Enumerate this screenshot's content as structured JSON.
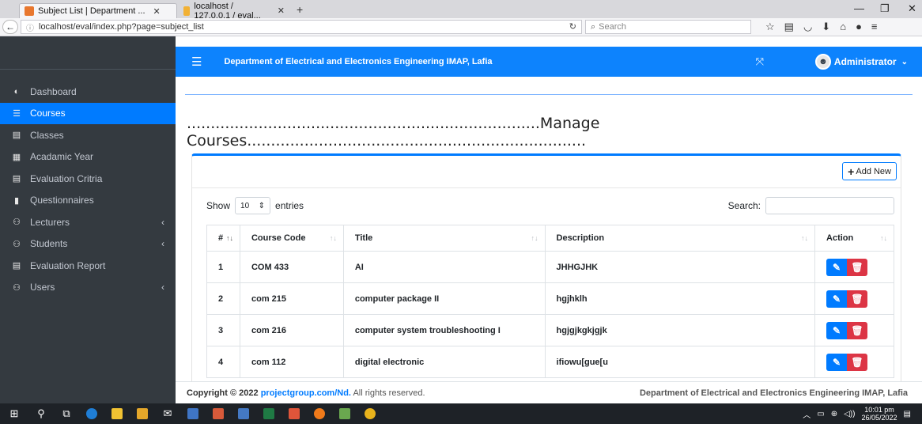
{
  "browser": {
    "tabs": [
      {
        "title": "Subject List | Department ...",
        "active": true
      },
      {
        "title": "localhost / 127.0.0.1 / eval...",
        "active": false
      }
    ],
    "new_tab": "+",
    "url": "localhost/eval/index.php?page=subject_list",
    "search_placeholder": "Search"
  },
  "navbar": {
    "title": "Department of Electrical and Electronics Engineering IMAP, Lafia",
    "user": "Administrator"
  },
  "sidebar": {
    "items": [
      {
        "label": "Dashboard",
        "icon": "dashboard-icon",
        "active": false,
        "has_children": false
      },
      {
        "label": "Courses",
        "icon": "list-icon",
        "active": true,
        "has_children": false
      },
      {
        "label": "Classes",
        "icon": "list-alt-icon",
        "active": false,
        "has_children": false
      },
      {
        "label": "Acadamic Year",
        "icon": "calendar-icon",
        "active": false,
        "has_children": false
      },
      {
        "label": "Evaluation Critria",
        "icon": "list-alt-icon",
        "active": false,
        "has_children": false
      },
      {
        "label": "Questionnaires",
        "icon": "file-icon",
        "active": false,
        "has_children": false
      },
      {
        "label": "Lecturers",
        "icon": "users-icon",
        "active": false,
        "has_children": true
      },
      {
        "label": "Students",
        "icon": "users-icon",
        "active": false,
        "has_children": true
      },
      {
        "label": "Evaluation Report",
        "icon": "list-alt-icon",
        "active": false,
        "has_children": false
      },
      {
        "label": "Users",
        "icon": "users-group-icon",
        "active": false,
        "has_children": true
      }
    ]
  },
  "page": {
    "heading_line1": "..........................................................................Manage",
    "heading_line2": "Courses.......................................................................",
    "add_new": "Add New",
    "show_label": "Show",
    "entries_value": "10",
    "entries_label": "entries",
    "search_label": "Search:"
  },
  "table": {
    "headers": [
      "#",
      "Course Code",
      "Title",
      "Description",
      "Action"
    ],
    "rows": [
      {
        "num": "1",
        "code": "COM 433",
        "title": "AI",
        "description": "JHHGJHK"
      },
      {
        "num": "2",
        "code": "com 215",
        "title": "computer package II",
        "description": "hgjhklh"
      },
      {
        "num": "3",
        "code": "com 216",
        "title": "computer system troubleshooting I",
        "description": "hgjgjkgkjgjk"
      },
      {
        "num": "4",
        "code": "com 112",
        "title": "digital electronic",
        "description": "ifiowu[gue[u"
      }
    ]
  },
  "footer": {
    "copyright_prefix": "Copyright © 2022",
    "link": "projectgroup.com/Nd.",
    "suffix": "All rights reserved.",
    "right": "Department of Electrical and Electronics Engineering IMAP, Lafia"
  },
  "taskbar": {
    "time": "10:01 pm",
    "date": "26/05/2022"
  },
  "colors": {
    "primary": "#007bff",
    "danger": "#dc3545",
    "sidebar_bg": "#343a40"
  }
}
